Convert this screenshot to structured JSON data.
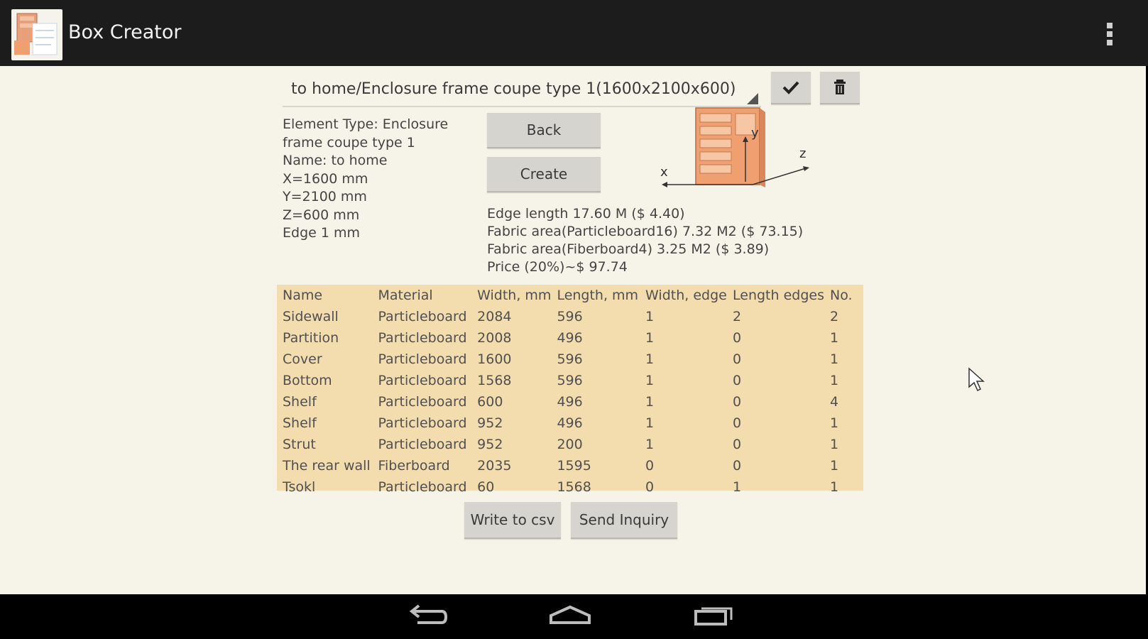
{
  "app": {
    "title": "Box Creator",
    "icon": "app-box-icon"
  },
  "header": {
    "overflow_icon": "overflow-menu-icon"
  },
  "spinner": {
    "selected": "to home/Enclosure frame coupe type 1(1600x2100x600)"
  },
  "toolbar": {
    "confirm_icon": "checkmark-icon",
    "delete_icon": "trash-icon"
  },
  "buttons": {
    "back": "Back",
    "create": "Create",
    "write_csv": "Write to csv",
    "send_inquiry": "Send Inquiry"
  },
  "element_info": {
    "type_line1": "Element Type: Enclosure",
    "type_line2": "frame coupe type 1",
    "name": "Name: to home",
    "x": "X=1600 mm",
    "y": "Y=2100 mm",
    "z": "Z=600 mm",
    "edge": "Edge 1 mm"
  },
  "diagram": {
    "x_label": "x",
    "y_label": "y",
    "z_label": "z"
  },
  "costs": {
    "edge_length": "Edge length 17.60 M ($ 4.40)",
    "fabric_particleboard": "Fabric area(Particleboard16) 7.32 M2 ($ 73.15)",
    "fabric_fiberboard": "Fabric area(Fiberboard4) 3.25 M2 ($ 3.89)",
    "price": "Price (20%)~$ 97.74"
  },
  "parts_table": {
    "headers": [
      "Name",
      "Material",
      "Width, mm",
      "Length, mm",
      "Width, edge",
      "Length edges",
      "No."
    ],
    "rows": [
      [
        "Sidewall",
        "Particleboard",
        "2084",
        "596",
        "1",
        "2",
        "2"
      ],
      [
        "Partition",
        "Particleboard",
        "2008",
        "496",
        "1",
        "0",
        "1"
      ],
      [
        "Cover",
        "Particleboard",
        "1600",
        "596",
        "1",
        "0",
        "1"
      ],
      [
        "Bottom",
        "Particleboard",
        "1568",
        "596",
        "1",
        "0",
        "1"
      ],
      [
        "Shelf",
        "Particleboard",
        "600",
        "496",
        "1",
        "0",
        "4"
      ],
      [
        "Shelf",
        "Particleboard",
        "952",
        "496",
        "1",
        "0",
        "1"
      ],
      [
        "Strut",
        "Particleboard",
        "952",
        "200",
        "1",
        "0",
        "1"
      ],
      [
        "The rear wall",
        "Fiberboard",
        "2035",
        "1595",
        "0",
        "0",
        "1"
      ],
      [
        "Tsokl",
        "Particleboard",
        "60",
        "1568",
        "0",
        "1",
        "1"
      ]
    ]
  },
  "navbar": {
    "back_icon": "nav-back-icon",
    "home_icon": "nav-home-icon",
    "recents_icon": "nav-recents-icon"
  },
  "colors": {
    "action_bar": "#1c1c1c",
    "background": "#f6f3e8",
    "table_bg": "#f3dcae",
    "button": "#d6d4ce",
    "cabinet": "#f0a070"
  }
}
